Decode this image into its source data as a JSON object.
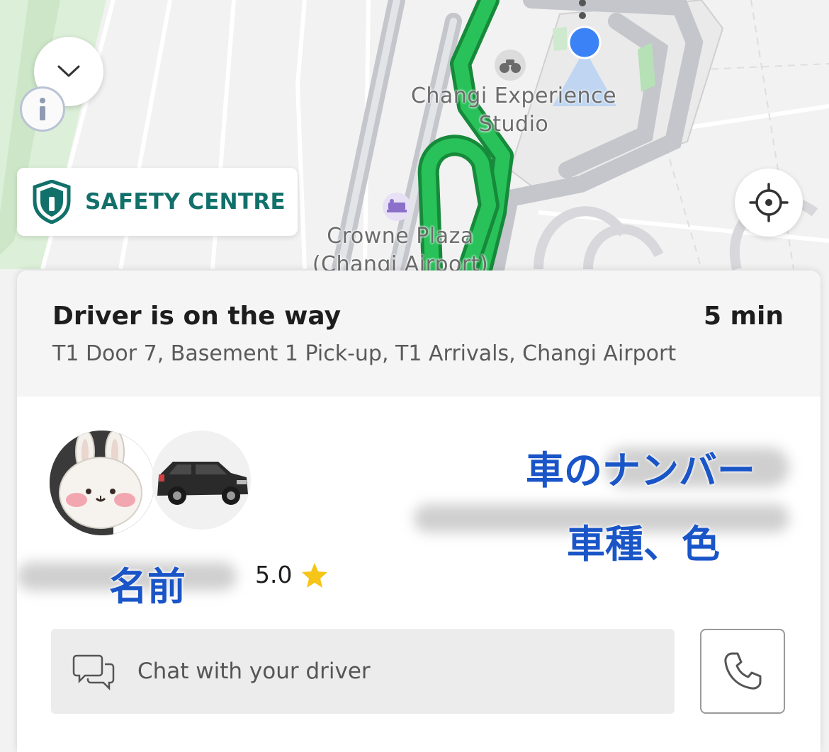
{
  "map": {
    "poi_1": {
      "line1": "Changi Experience",
      "line2": "Studio",
      "icon": "binoculars-icon"
    },
    "poi_2": {
      "line1": "Crowne Plaza",
      "line2": "(Changi Airport)",
      "icon": "hotel-bed-icon"
    },
    "route_color": "#22b14c",
    "user_location_color": "#3b82f6"
  },
  "controls": {
    "collapse_icon": "chevron-down-icon",
    "info_icon": "info-icon",
    "safety_label": "SAFETY CENTRE",
    "safety_icon": "shield-icon",
    "locate_icon": "crosshair-icon",
    "safety_color": "#12706a"
  },
  "trip": {
    "status": "Driver is on the way",
    "eta": "5 min",
    "pickup": "T1 Door 7, Basement 1 Pick-up, T1 Arrivals, Changi Airport"
  },
  "driver": {
    "rating": "5.0",
    "rating_icon": "star-icon",
    "star_color": "#f5c518"
  },
  "annotations": {
    "plate": "車のナンバー",
    "vehicle": "車種、色",
    "name": "名前",
    "color": "#1a55c8"
  },
  "chat": {
    "placeholder": "Chat with your driver",
    "chat_icon": "chat-bubbles-icon",
    "call_icon": "phone-icon"
  }
}
